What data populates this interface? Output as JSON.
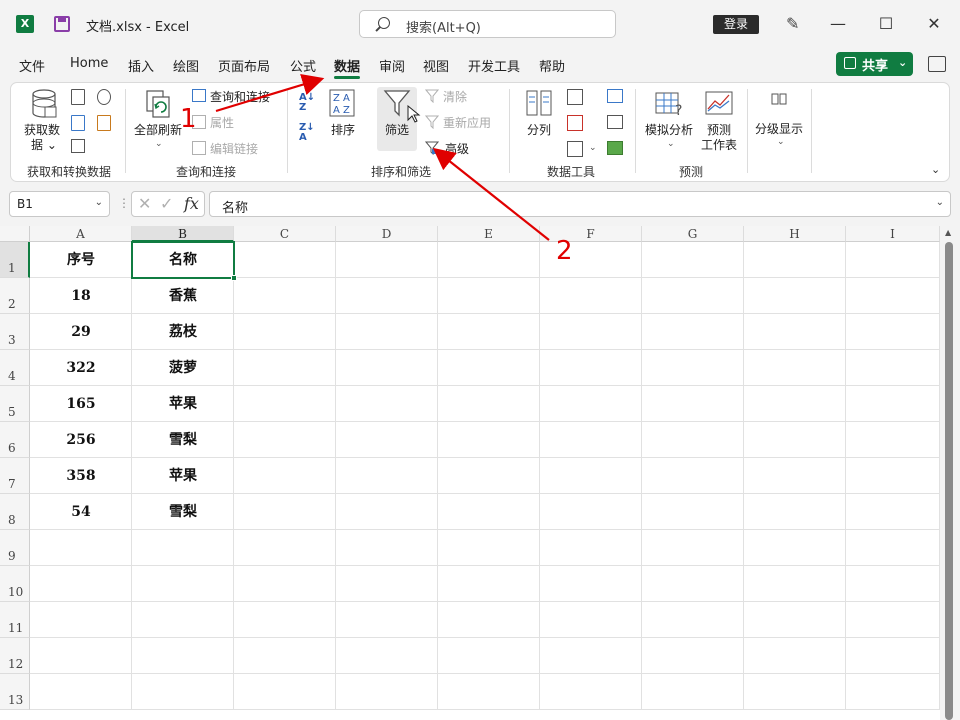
{
  "titlebar": {
    "app_logo": "X",
    "doc_title": "文档.xlsx  -  Excel",
    "search_placeholder": "搜索(Alt+Q)",
    "login": "登录",
    "minimize": "—",
    "maximize": "☐",
    "close": "✕"
  },
  "tabs": [
    "文件",
    "Home",
    "插入",
    "绘图",
    "页面布局",
    "公式",
    "数据",
    "审阅",
    "视图",
    "开发工具",
    "帮助"
  ],
  "active_tab": "数据",
  "share": {
    "label": "共享",
    "caret": "⌄"
  },
  "ribbon": {
    "get_data": {
      "label1": "获取数",
      "label2": "据 ⌄"
    },
    "refresh_all": {
      "label": "全部刷新",
      "caret": "⌄"
    },
    "query_links": "查询和连接",
    "properties": "属性",
    "edit_links": "编辑链接",
    "sort": "排序",
    "filter": "筛选",
    "clear": "清除",
    "reapply": "重新应用",
    "advanced": "高级",
    "text_to_columns": "分列",
    "what_if": "模拟分析",
    "forecast_sheet1": "预测",
    "forecast_sheet2": "工作表",
    "outline": "分级显示",
    "groups": {
      "get_transform": "获取和转换数据",
      "queries": "查询和连接",
      "sort_filter": "排序和筛选",
      "data_tools": "数据工具",
      "forecast": "预测"
    }
  },
  "formula_bar": {
    "name_box": "B1",
    "cancel": "✕",
    "enter": "✓",
    "fx": "fx",
    "value": "名称"
  },
  "sheet": {
    "columns": [
      "A",
      "B",
      "C",
      "D",
      "E",
      "F",
      "G",
      "H",
      "I"
    ],
    "rows": [
      "1",
      "2",
      "3",
      "4",
      "5",
      "6",
      "7",
      "8",
      "9",
      "10",
      "11",
      "12",
      "13"
    ],
    "cells": [
      [
        "序号",
        "名称"
      ],
      [
        "18",
        "香蕉"
      ],
      [
        "29",
        "荔枝"
      ],
      [
        "322",
        "菠萝"
      ],
      [
        "165",
        "苹果"
      ],
      [
        "256",
        "雪梨"
      ],
      [
        "358",
        "苹果"
      ],
      [
        "54",
        "雪梨"
      ]
    ],
    "selected_cell": "B1"
  },
  "annotations": {
    "label1": "1",
    "label2": "2",
    "color": "#e00000"
  },
  "colors": {
    "accent": "#107c41",
    "annotation": "#e00000"
  }
}
